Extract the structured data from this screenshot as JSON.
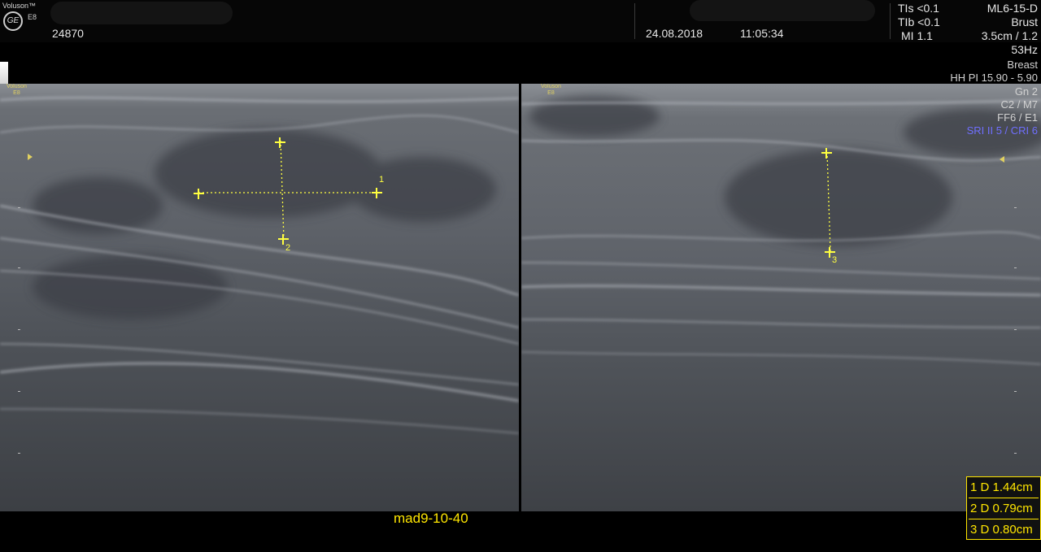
{
  "header": {
    "logo_brand": "Voluson™",
    "logo_badge": "GE",
    "logo_model": "E8",
    "patient_id": "24870",
    "date": "24.08.2018",
    "time": "11:05:34",
    "safety": {
      "tis": "TIs <0.1",
      "tib": "TIb <0.1",
      "mi": "MI  1.1"
    }
  },
  "params": {
    "probe": "ML6-15-D",
    "application": "Brust",
    "depth": "3.5cm / 1.2",
    "frequency": "53Hz",
    "preset": "Breast",
    "hh_pi": "HH PI 15.90 - 5.90",
    "gain": "Gn  2",
    "c_m": "C2 / M7",
    "ff_e": "FF6 / E1",
    "sri_cri": "SRI II 5 / CRI 6"
  },
  "left_panel": {
    "brand": "Voluson",
    "model": "E8",
    "caliper_labels": [
      "1",
      "2"
    ]
  },
  "right_panel": {
    "brand": "Voluson",
    "model": "E8",
    "caliper_labels": [
      "3"
    ]
  },
  "annotation": "mad9-10-40",
  "measurements": [
    {
      "label": "1 D 1.44cm"
    },
    {
      "label": "2 D 0.79cm"
    },
    {
      "label": "3 D 0.80cm"
    }
  ],
  "colors": {
    "caliper": "#ffff40",
    "annotation": "#ffe600",
    "sri": "#6f6fff"
  }
}
